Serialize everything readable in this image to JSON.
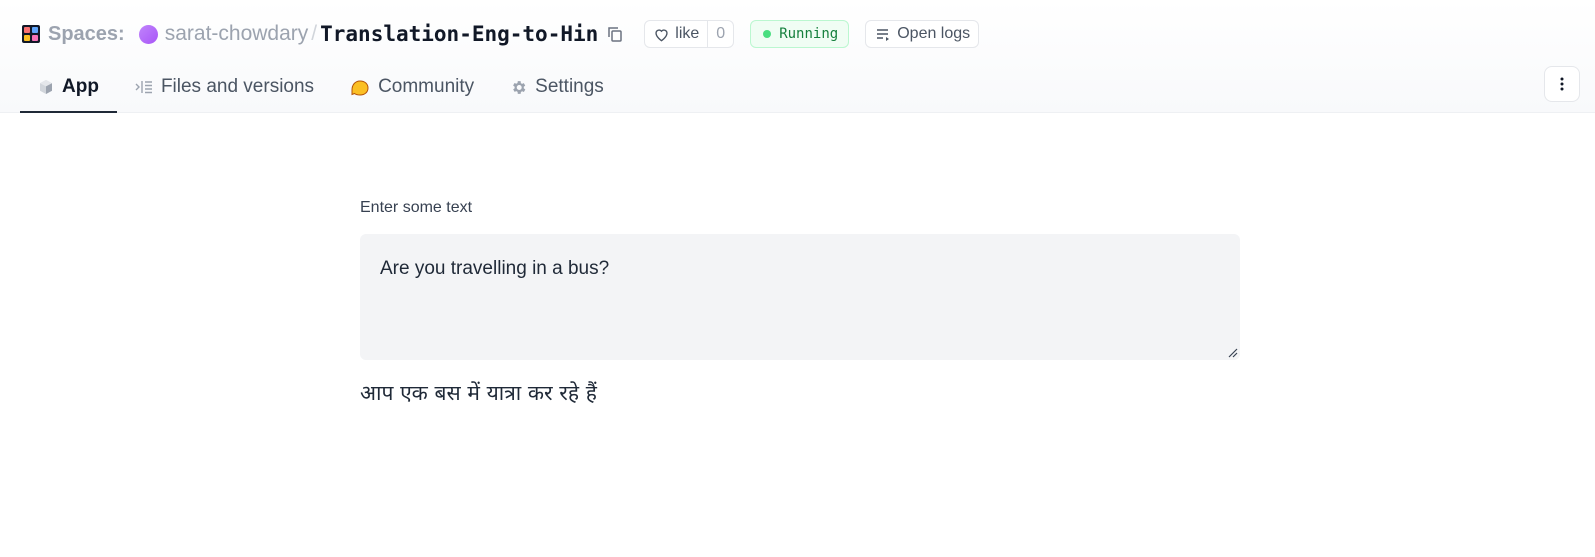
{
  "header": {
    "spaces_label": "Spaces:",
    "owner": "sarat-chowdary",
    "separator": "/",
    "repo_name": "Translation-Eng-to-Hin",
    "like_label": "like",
    "like_count": "0",
    "status": "Running",
    "open_logs_label": "Open logs"
  },
  "tabs": [
    {
      "label": "App",
      "icon": "cube-icon",
      "active": true
    },
    {
      "label": "Files and versions",
      "icon": "files-icon",
      "active": false
    },
    {
      "label": "Community",
      "icon": "community-icon",
      "active": false
    },
    {
      "label": "Settings",
      "icon": "gear-icon",
      "active": false
    }
  ],
  "app": {
    "input_label": "Enter some text",
    "input_value": "Are you travelling in a bus?",
    "output_text": "आप एक बस में यात्रा कर रहे हैं"
  },
  "colors": {
    "status_green": "#15803d",
    "avatar_purple": "#a855f7",
    "active_tab_underline": "#1f2937",
    "community_yellow": "#fbbf24"
  }
}
